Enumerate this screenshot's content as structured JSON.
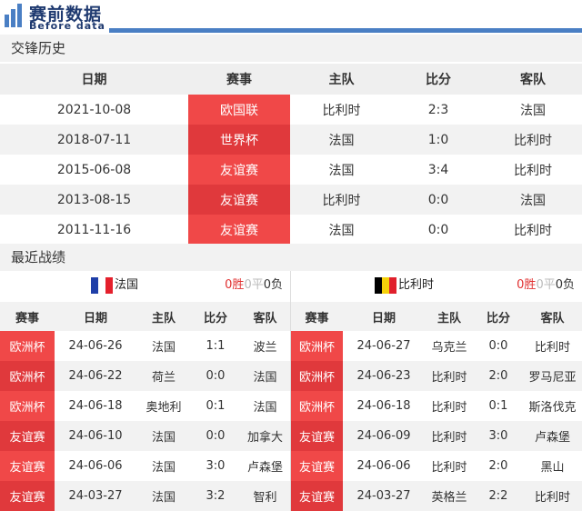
{
  "header": {
    "title": "赛前数据",
    "subtitle": "Before data"
  },
  "h2h": {
    "section_title": "交锋历史",
    "columns": [
      "日期",
      "赛事",
      "主队",
      "比分",
      "客队"
    ],
    "rows": [
      {
        "date": "2021-10-08",
        "competition": "欧国联",
        "home": "比利时",
        "score": "2:3",
        "away": "法国",
        "comp_color": "#f04848"
      },
      {
        "date": "2018-07-11",
        "competition": "世界杯",
        "home": "法国",
        "score": "1:0",
        "away": "比利时",
        "comp_color": "#e0393c"
      },
      {
        "date": "2015-06-08",
        "competition": "友谊赛",
        "home": "法国",
        "score": "3:4",
        "away": "比利时",
        "comp_color": "#f04848"
      },
      {
        "date": "2013-08-15",
        "competition": "友谊赛",
        "home": "比利时",
        "score": "0:0",
        "away": "法国",
        "comp_color": "#e0393c"
      },
      {
        "date": "2011-11-16",
        "competition": "友谊赛",
        "home": "法国",
        "score": "0:0",
        "away": "比利时",
        "comp_color": "#f04848"
      }
    ]
  },
  "recent": {
    "section_title": "最近战绩",
    "columns": [
      "赛事",
      "日期",
      "主队",
      "比分",
      "客队"
    ],
    "left": {
      "team": "法国",
      "flag_colors": [
        "#1f3fa8",
        "#ffffff",
        "#e4202c"
      ],
      "wins": "0胜",
      "draws": "0平",
      "losses": "0负",
      "rows": [
        {
          "competition": "欧洲杯",
          "date": "24-06-26",
          "home": "法国",
          "score": "1:1",
          "away": "波兰"
        },
        {
          "competition": "欧洲杯",
          "date": "24-06-22",
          "home": "荷兰",
          "score": "0:0",
          "away": "法国"
        },
        {
          "competition": "欧洲杯",
          "date": "24-06-18",
          "home": "奥地利",
          "score": "0:1",
          "away": "法国"
        },
        {
          "competition": "友谊赛",
          "date": "24-06-10",
          "home": "法国",
          "score": "0:0",
          "away": "加拿大"
        },
        {
          "competition": "友谊赛",
          "date": "24-06-06",
          "home": "法国",
          "score": "3:0",
          "away": "卢森堡"
        },
        {
          "competition": "友谊赛",
          "date": "24-03-27",
          "home": "法国",
          "score": "3:2",
          "away": "智利"
        }
      ]
    },
    "right": {
      "team": "比利时",
      "flag_colors": [
        "#000000",
        "#f5d10a",
        "#e0202c"
      ],
      "wins": "0胜",
      "draws": "0平",
      "losses": "0负",
      "rows": [
        {
          "competition": "欧洲杯",
          "date": "24-06-27",
          "home": "乌克兰",
          "score": "0:0",
          "away": "比利时"
        },
        {
          "competition": "欧洲杯",
          "date": "24-06-23",
          "home": "比利时",
          "score": "2:0",
          "away": "罗马尼亚"
        },
        {
          "competition": "欧洲杯",
          "date": "24-06-18",
          "home": "比利时",
          "score": "0:1",
          "away": "斯洛伐克"
        },
        {
          "competition": "友谊赛",
          "date": "24-06-09",
          "home": "比利时",
          "score": "3:0",
          "away": "卢森堡"
        },
        {
          "competition": "友谊赛",
          "date": "24-06-06",
          "home": "比利时",
          "score": "2:0",
          "away": "黑山"
        },
        {
          "competition": "友谊赛",
          "date": "24-03-27",
          "home": "英格兰",
          "score": "2:2",
          "away": "比利时"
        }
      ]
    }
  },
  "colors": {
    "accent_blue": "#4a7fc4",
    "comp_red": "#f04848",
    "comp_red_dark": "#e0393c"
  }
}
